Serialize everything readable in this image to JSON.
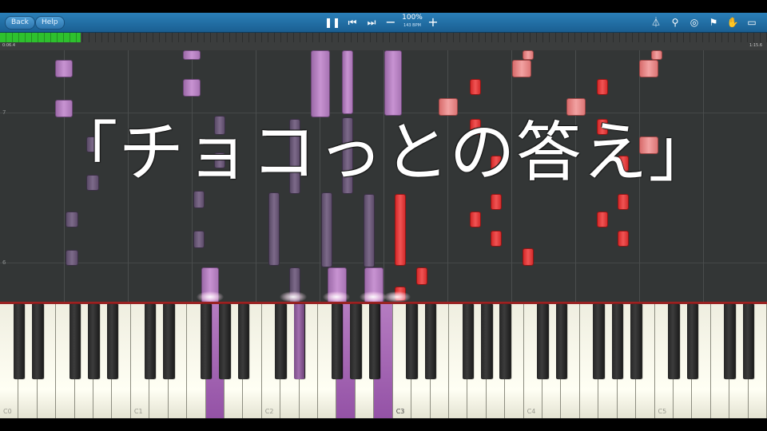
{
  "toolbar": {
    "back_label": "Back",
    "help_label": "Help",
    "speed_percent": "100%",
    "speed_bpm": "143 BPM",
    "icons": [
      "pause-icon",
      "previous-icon",
      "next-icon",
      "minus-icon",
      "plus-icon",
      "metronome-icon",
      "magnifier-icon",
      "loop-icon",
      "marker-icon",
      "hand-icon",
      "keyboard-icon"
    ]
  },
  "progress": {
    "fraction": 0.105,
    "elapsed": "0:06.4",
    "total": "1:15.6"
  },
  "roll": {
    "measures": [
      "7",
      "6"
    ]
  },
  "overlay": {
    "title": "「チョコっとの答え」"
  },
  "keyboard": {
    "octave_labels": [
      "C0",
      "C1",
      "C2",
      "C3",
      "C4",
      "C5"
    ]
  },
  "colors": {
    "left_hand": "#c893d2",
    "left_hand_dim": "#7d6a8a",
    "right_hand": "#f05454",
    "right_hand_light": "#f2a2a2",
    "toolbar": "#2a7fb8",
    "progress": "#2ec02e"
  }
}
